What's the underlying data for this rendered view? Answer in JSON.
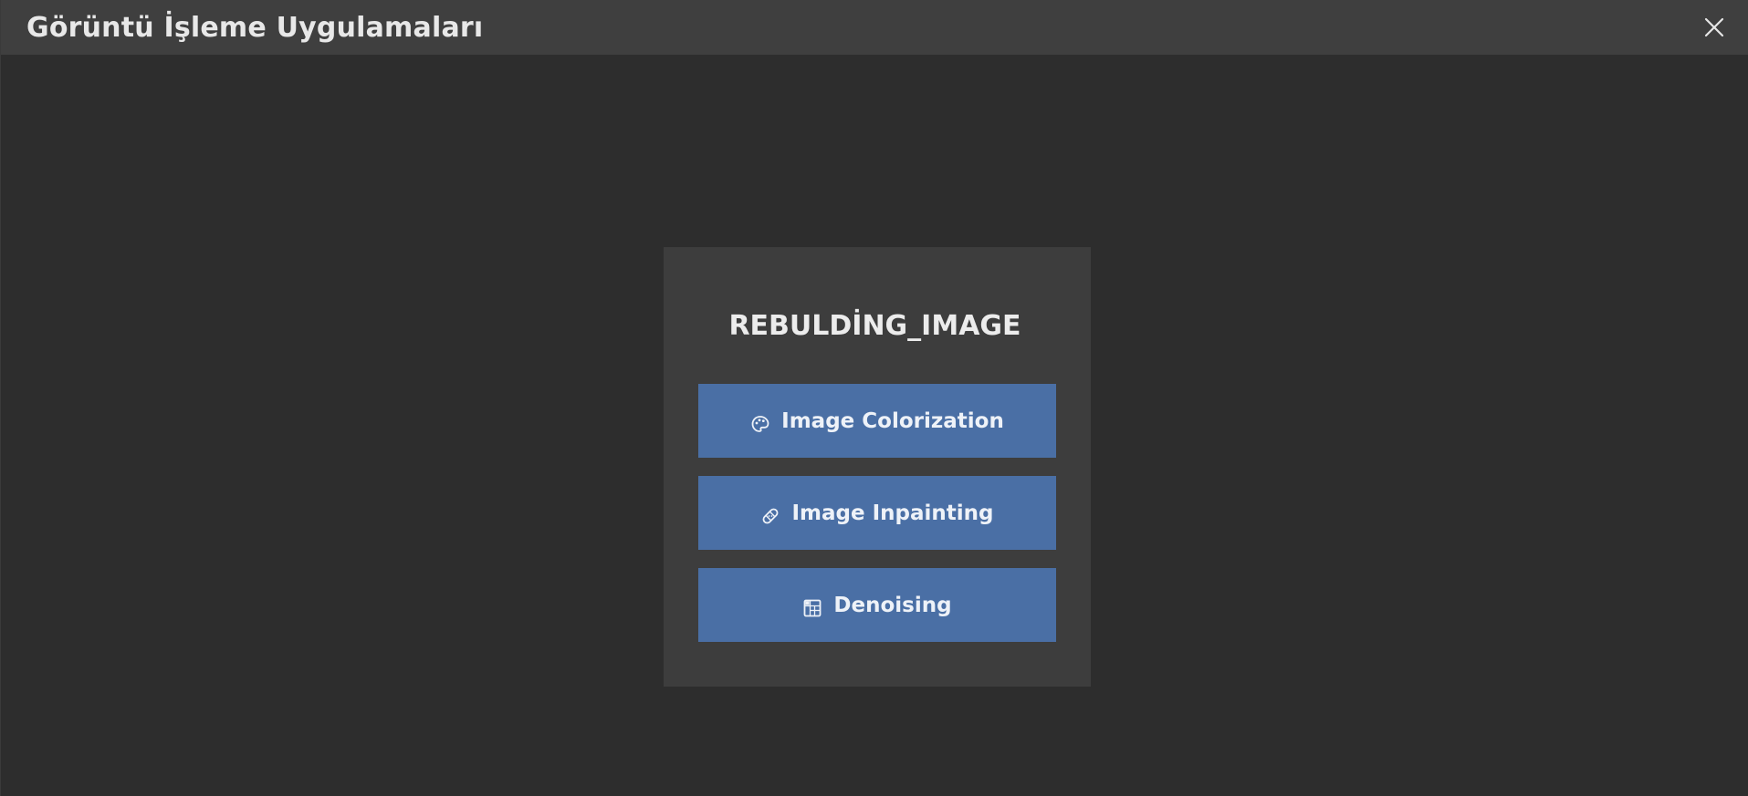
{
  "window": {
    "title": "Görüntü İşleme Uygulamaları",
    "close_icon": "close-icon"
  },
  "panel": {
    "title": "REBULDİNG_IMAGE",
    "buttons": [
      {
        "label": "Image Colorization",
        "icon": "palette-icon"
      },
      {
        "label": "Image Inpainting",
        "icon": "bandage-icon"
      },
      {
        "label": "Denoising",
        "icon": "image-grid-icon"
      }
    ]
  },
  "colors": {
    "titlebar": "#3f3f3f",
    "background": "#2d2d2d",
    "panel": "#3d3d3d",
    "button": "#4a6fa5",
    "text": "#ececec"
  }
}
